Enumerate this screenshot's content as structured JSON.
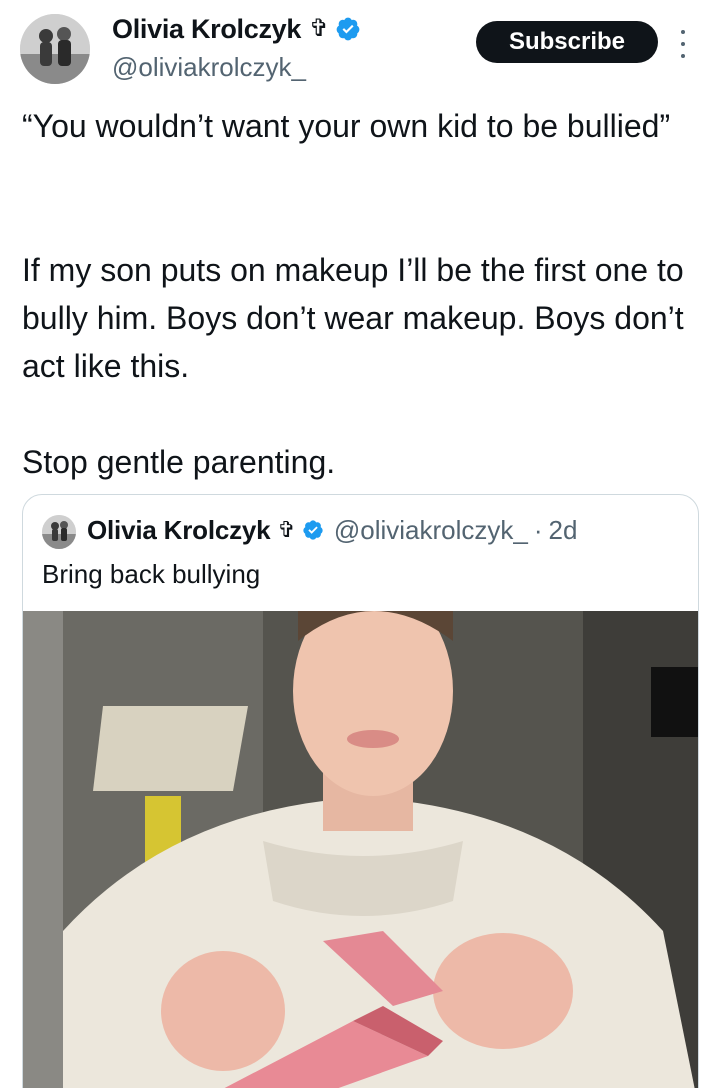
{
  "author": {
    "display_name": "Olivia Krolczyk",
    "cross_symbol": "✞",
    "handle": "@oliviakrolczyk_",
    "verified_icon": "verified-badge-icon",
    "verified_color": "#1d9bf0"
  },
  "actions": {
    "subscribe_label": "Subscribe",
    "more_icon": "more-vertical-icon"
  },
  "tweet": {
    "paragraph_1": "“You wouldn’t want your own kid to be bullied”",
    "paragraph_2": "If my son puts on makeup I’ll be the first one to bully him. Boys don’t wear makeup. Boys don’t act like this.",
    "paragraph_3": "Stop gentle parenting."
  },
  "quoted_tweet": {
    "display_name": "Olivia Krolczyk",
    "cross_symbol": "✞",
    "handle": "@oliviakrolczyk_",
    "separator": "·",
    "time": "2d",
    "text": "Bring back bullying",
    "media_alt": "video still of a boy holding a pink makeup case"
  }
}
